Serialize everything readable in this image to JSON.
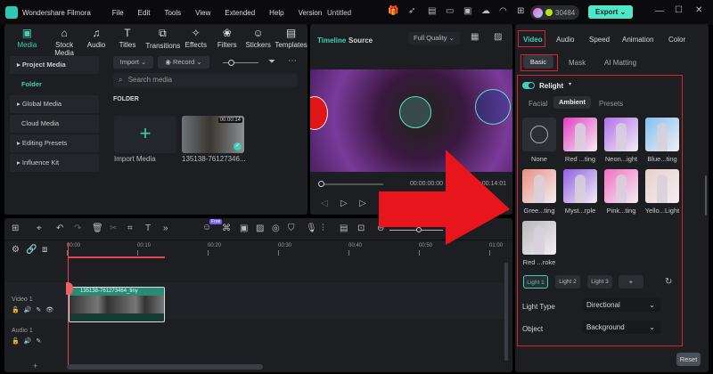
{
  "app": {
    "title": "Wondershare Filmora",
    "menu": [
      "File",
      "Edit",
      "Tools",
      "View",
      "Extended",
      "Help",
      "Version"
    ],
    "project": "Untitled",
    "credits": "30484",
    "export": "Export"
  },
  "media_tabs": [
    {
      "label": "Media",
      "icon": "media-icon"
    },
    {
      "label": "Stock Media",
      "icon": "stock-icon"
    },
    {
      "label": "Audio",
      "icon": "music-icon"
    },
    {
      "label": "Titles",
      "icon": "text-icon"
    },
    {
      "label": "Transitions",
      "icon": "transition-icon"
    },
    {
      "label": "Effects",
      "icon": "effects-icon"
    },
    {
      "label": "Filters",
      "icon": "filters-icon"
    },
    {
      "label": "Stickers",
      "icon": "sticker-icon"
    },
    {
      "label": "Templates",
      "icon": "template-icon"
    }
  ],
  "sidebar": {
    "items": [
      "Project Media",
      "Folder",
      "Global Media",
      "Cloud Media",
      "Editing Presets",
      "Influence Kit"
    ]
  },
  "library": {
    "import": "Import",
    "record": "Record",
    "search_placeholder": "Search media",
    "folder_heading": "FOLDER",
    "import_media": "Import Media",
    "clip_name": "135138-76127346...",
    "clip_duration": "00:00:14"
  },
  "preview": {
    "tabs": [
      "Timeline",
      "Source"
    ],
    "quality": "Full Quality",
    "current_time": "00:00:00:00",
    "separator": "/",
    "total_time": "00:00:14:01"
  },
  "props": {
    "tabs": [
      "Video",
      "Audio",
      "Speed",
      "Animation",
      "Color"
    ],
    "subtabs": [
      "Basic",
      "Mask",
      "AI Matting"
    ],
    "relight": "Relight",
    "modes": [
      "Facial",
      "Ambient",
      "Presets"
    ],
    "presets": [
      {
        "label": "None",
        "color": "none"
      },
      {
        "label": "Red ...ting",
        "color": "#e040c0"
      },
      {
        "label": "Neon...ight",
        "color": "#b070e8"
      },
      {
        "label": "Blue...ting",
        "color": "#80c0f0"
      },
      {
        "label": "Gree...ting",
        "color": "#e89080"
      },
      {
        "label": "Myst...rple",
        "color": "#9060e0"
      },
      {
        "label": "Pink...ting",
        "color": "#f070c0"
      },
      {
        "label": "Yello...Light",
        "color": "#e8d0c8"
      },
      {
        "label": "Red ...roke",
        "color": "#b8b8b8"
      }
    ],
    "lights": [
      "Light 1",
      "Light 2",
      "Light 3",
      "+"
    ],
    "light_type_label": "Light Type",
    "light_type": "Directional",
    "object_label": "Object",
    "object": "Background",
    "reset": "Reset"
  },
  "timeline": {
    "ruler": [
      "00:00",
      "00:10",
      "00:20",
      "00:30",
      "00:40",
      "00:50",
      "01:00"
    ],
    "clip": "135138-761273464_tiny",
    "tracks": [
      "Video 1",
      "Audio 1"
    ],
    "ai_badge": "Free"
  }
}
